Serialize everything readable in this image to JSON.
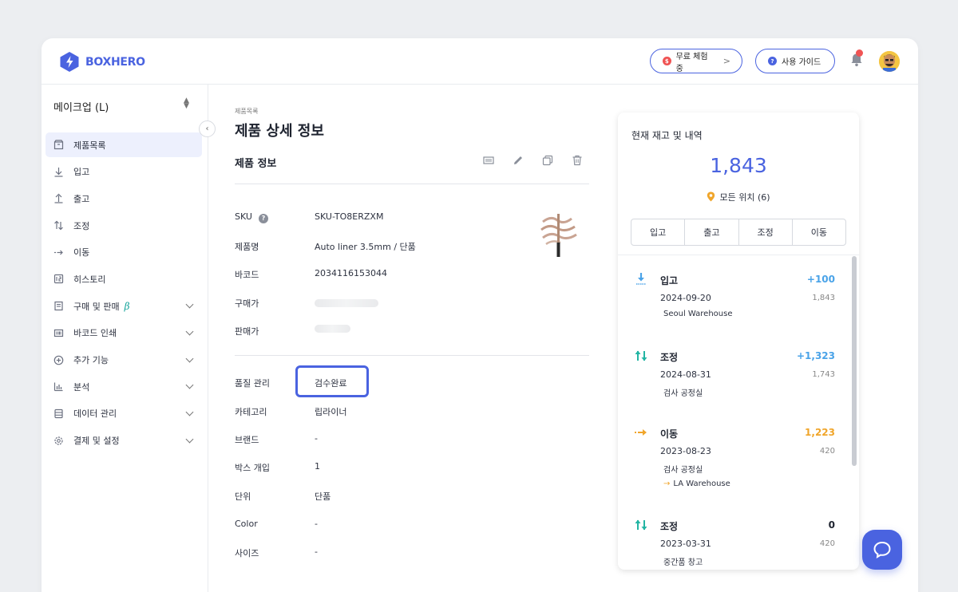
{
  "app": {
    "brand": "BOXHERO",
    "trial_label": "무료 체험중",
    "trial_badge": "$",
    "guide_label": "사용 가이드",
    "guide_badge": "?"
  },
  "sidebar": {
    "workspace": "메이크업 (L)",
    "items": [
      {
        "label": "제품목록",
        "icon": "box-icon",
        "active": true
      },
      {
        "label": "입고",
        "icon": "arrow-down-icon"
      },
      {
        "label": "출고",
        "icon": "arrow-up-icon"
      },
      {
        "label": "조정",
        "icon": "swap-vertical-icon"
      },
      {
        "label": "이동",
        "icon": "move-arrow-icon"
      },
      {
        "label": "히스토리",
        "icon": "history-icon"
      },
      {
        "label": "구매 및 판매",
        "icon": "receipt-icon",
        "badge": "β",
        "expandable": true
      },
      {
        "label": "바코드 인쇄",
        "icon": "barcode-icon",
        "expandable": true
      },
      {
        "label": "추가 기능",
        "icon": "plus-circle-icon",
        "expandable": true
      },
      {
        "label": "분석",
        "icon": "chart-icon",
        "expandable": true
      },
      {
        "label": "데이터 관리",
        "icon": "database-icon",
        "expandable": true
      },
      {
        "label": "결제 및 설정",
        "icon": "settings-icon",
        "expandable": true
      }
    ]
  },
  "main": {
    "breadcrumb": "제품목록",
    "title": "제품 상세 정보",
    "section_title": "제품 정보",
    "fields": {
      "sku_label": "SKU",
      "sku_value": "SKU-TO8ERZXM",
      "name_label": "제품명",
      "name_value": "Auto liner 3.5mm / 단품",
      "barcode_label": "바코드",
      "barcode_value": "2034116153044",
      "cost_label": "구매가",
      "price_label": "판매가",
      "quality_label": "품질 관리",
      "quality_value": "검수완료",
      "category_label": "카테고리",
      "category_value": "립라이너",
      "brand_label": "브랜드",
      "brand_value": "-",
      "box_label": "박스 개입",
      "box_value": "1",
      "unit_label": "단위",
      "unit_value": "단품",
      "color_label": "Color",
      "color_value": "-",
      "size_label": "사이즈",
      "size_value": "-"
    }
  },
  "panel": {
    "title": "현재 재고 및 내역",
    "total": "1,843",
    "location": "모든 위치 (6)",
    "actions": [
      "입고",
      "출고",
      "조정",
      "이동"
    ],
    "history": [
      {
        "type": "입고",
        "qty": "+100",
        "date": "2024-09-20",
        "balance": "1,843",
        "location": "Seoul Warehouse",
        "dest": "",
        "color": "#4aa3e8",
        "icon": "stock-in-icon"
      },
      {
        "type": "조정",
        "qty": "+1,323",
        "date": "2024-08-31",
        "balance": "1,743",
        "location": "검사 공정실",
        "dest": "",
        "color": "#4aa3e8",
        "icon": "adjust-icon"
      },
      {
        "type": "이동",
        "qty": "1,223",
        "date": "2023-08-23",
        "balance": "420",
        "location": "검사 공정실",
        "dest": "LA Warehouse",
        "color": "#f0a52a",
        "icon": "move-icon"
      },
      {
        "type": "조정",
        "qty": "0",
        "date": "2023-03-31",
        "balance": "420",
        "location": "중간품 창고",
        "dest": "",
        "color": "#1f2430",
        "icon": "adjust-icon"
      }
    ]
  },
  "colors": {
    "accent": "#4a63e0",
    "active_bg": "#edf0fd",
    "in_blue": "#4aa3e8",
    "move_orange": "#f0a52a",
    "adjust_green": "#22b5a3"
  }
}
